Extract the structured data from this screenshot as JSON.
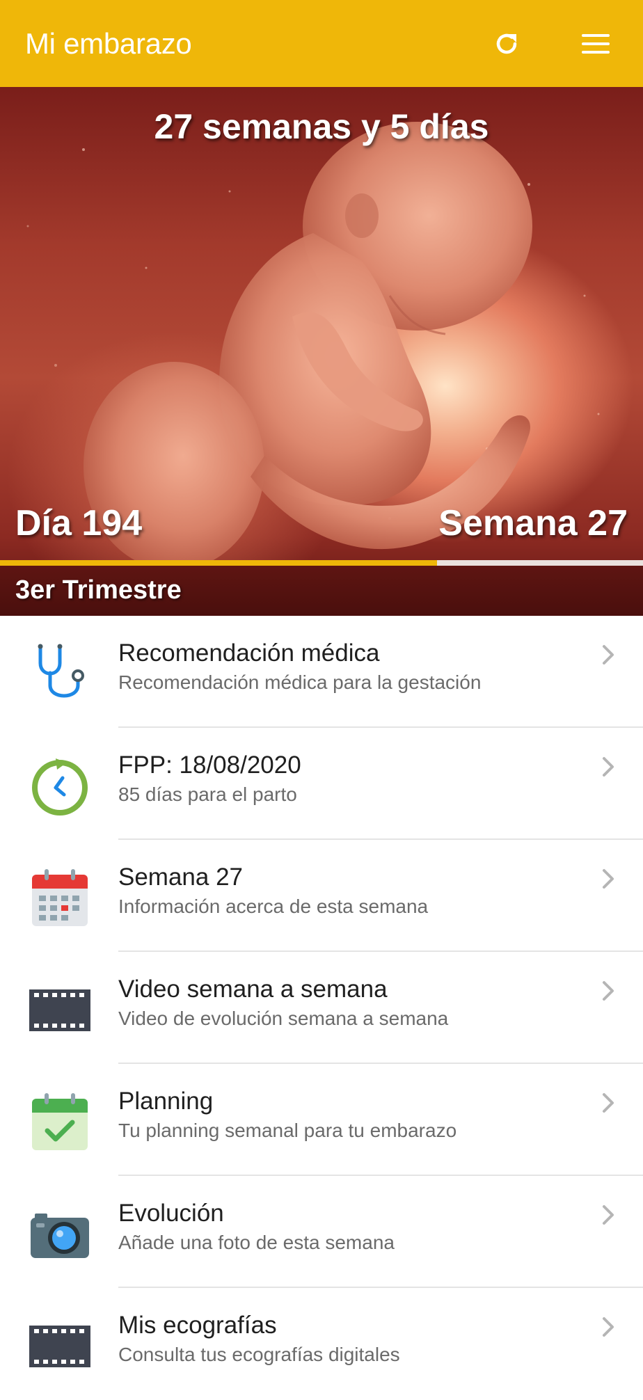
{
  "appbar": {
    "title": "Mi embarazo",
    "background_color": "#EFB709",
    "actions": [
      {
        "icon": "refresh-icon"
      },
      {
        "icon": "hamburger-menu-icon"
      }
    ]
  },
  "hero": {
    "heading": "27 semanas y 5 días",
    "day_label": "Día 194",
    "week_label": "Semana 27",
    "trimester_label": "3er Trimestre",
    "progress_fraction": 0.68,
    "image": "fetus-illustration"
  },
  "menu": {
    "items": [
      {
        "title": "Recomendación médica",
        "subtitle": "Recomendación médica para la gestación",
        "icon": "stethoscope-icon"
      },
      {
        "title": "FPP: 18/08/2020",
        "subtitle": "85 días para el parto",
        "icon": "countdown-clock-icon"
      },
      {
        "title": "Semana 27",
        "subtitle": "Información acerca de esta semana",
        "icon": "calendar-icon"
      },
      {
        "title": "Video semana a semana",
        "subtitle": "Video de evolución semana a semana",
        "icon": "film-strip-icon"
      },
      {
        "title": "Planning",
        "subtitle": "Tu planning semanal para tu embarazo",
        "icon": "calendar-check-icon"
      },
      {
        "title": "Evolución",
        "subtitle": "Añade una foto de esta semana",
        "icon": "camera-icon"
      },
      {
        "title": "Mis ecografías",
        "subtitle": "Consulta tus ecografías digitales",
        "icon": "film-strip-icon"
      }
    ]
  }
}
